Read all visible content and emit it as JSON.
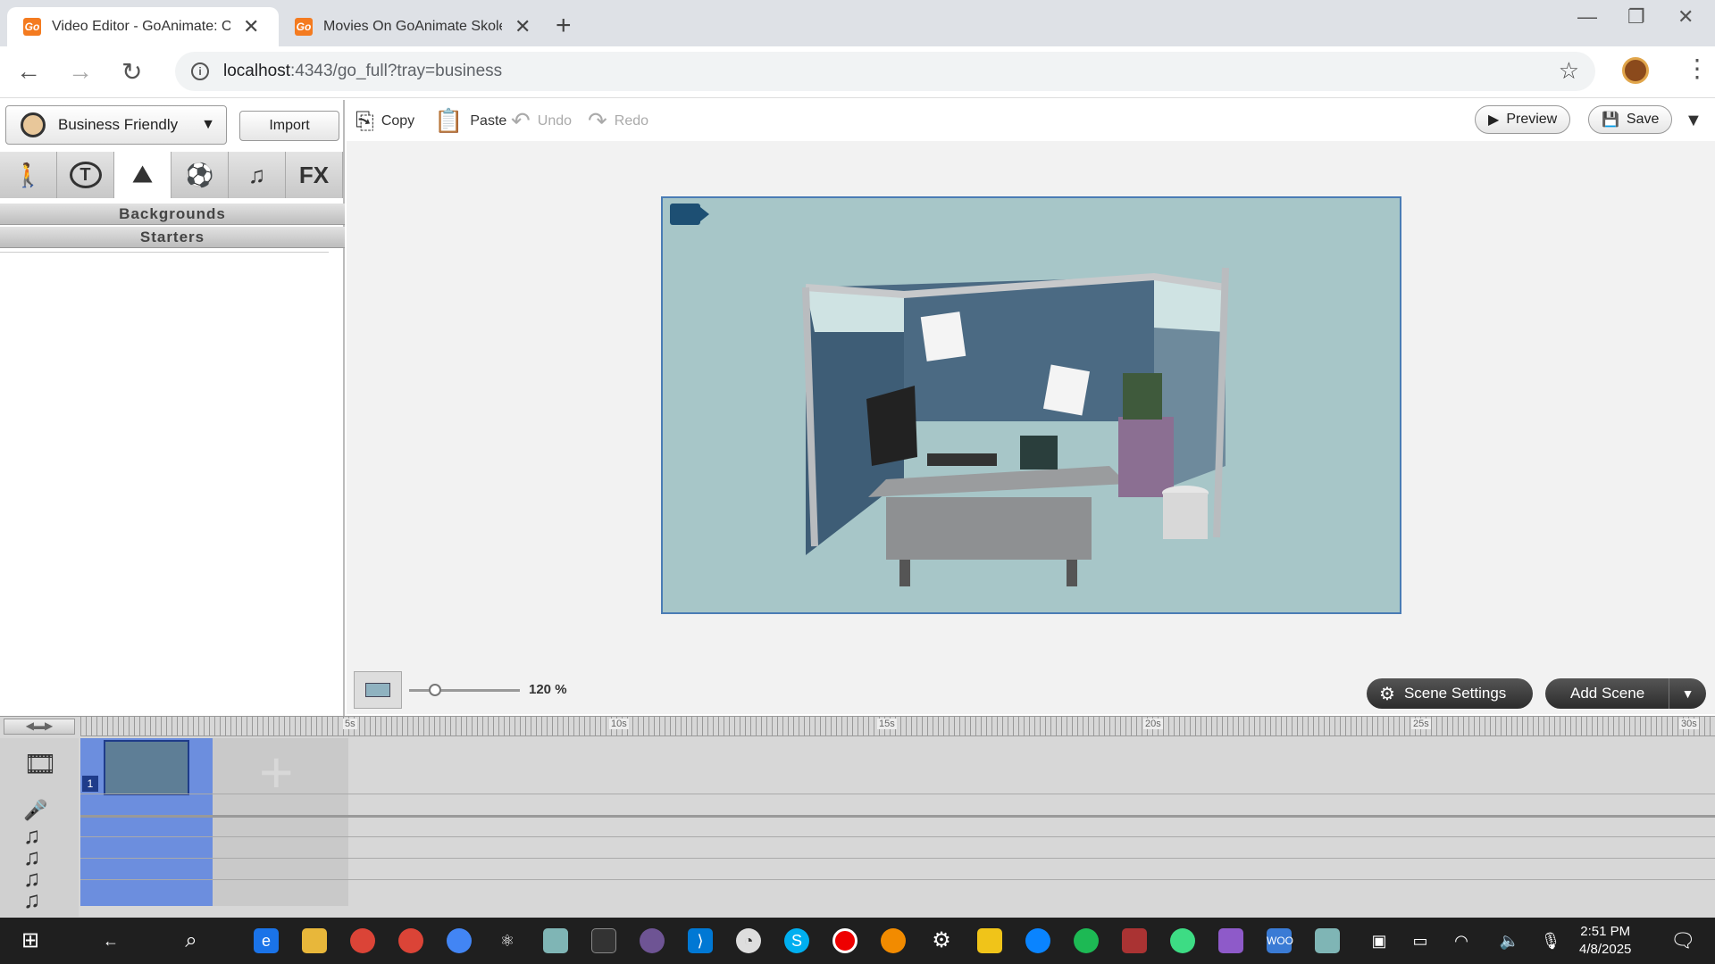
{
  "browser": {
    "tabs": [
      {
        "title": "Video Editor - GoAnimate: Onli",
        "favicon": "Go"
      },
      {
        "title": "Movies On GoAnimate SkoleTu",
        "favicon": "Go"
      }
    ],
    "url_host": "localhost",
    "url_rest": ":4343/go_full?tray=business"
  },
  "editor": {
    "theme_selector": "Business Friendly",
    "import_label": "Import",
    "category_tabs": [
      {
        "name": "character",
        "glyph": "🚶"
      },
      {
        "name": "speech",
        "glyph": "T"
      },
      {
        "name": "background",
        "glyph": "⛰"
      },
      {
        "name": "props",
        "glyph": "⚽"
      },
      {
        "name": "music",
        "glyph": "♫"
      },
      {
        "name": "effects",
        "glyph": "FX"
      }
    ],
    "accordion": [
      "Backgrounds",
      "Starters"
    ],
    "toolbar": {
      "copy": "Copy",
      "paste": "Paste",
      "undo": "Undo",
      "redo": "Redo",
      "preview": "Preview",
      "save": "Save"
    },
    "zoom": "120 %",
    "scene_settings": "Scene Settings",
    "add_scene": "Add Scene"
  },
  "timeline": {
    "ticks": [
      "5s",
      "10s",
      "15s",
      "20s",
      "25s",
      "30s"
    ],
    "scene_number": "1"
  },
  "taskbar": {
    "time": "2:51 PM",
    "date": "4/8/2025"
  },
  "colors": {
    "stage_bg": "#a7c6c8",
    "accent": "#f47b20",
    "scene_highlight": "#6c8ede"
  }
}
